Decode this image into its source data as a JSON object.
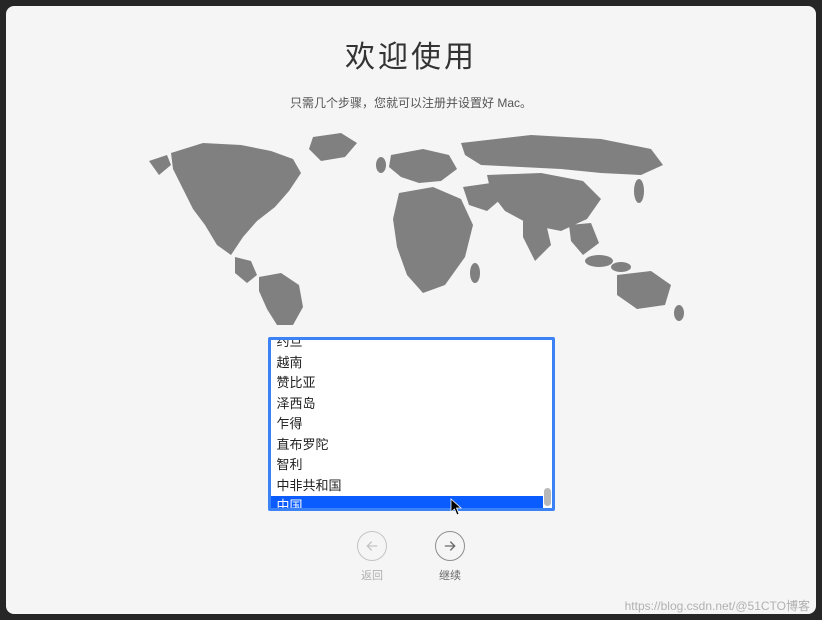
{
  "title": "欢迎使用",
  "subtitle": "只需几个步骤，您就可以注册并设置好 Mac。",
  "countries": {
    "items": [
      "约旦",
      "越南",
      "赞比亚",
      "泽西岛",
      "乍得",
      "直布罗陀",
      "智利",
      "中非共和国",
      "中国"
    ],
    "selected": "中国"
  },
  "nav": {
    "back_label": "返回",
    "continue_label": "继续"
  },
  "watermark": "https://blog.csdn.net/@51CTO博客"
}
